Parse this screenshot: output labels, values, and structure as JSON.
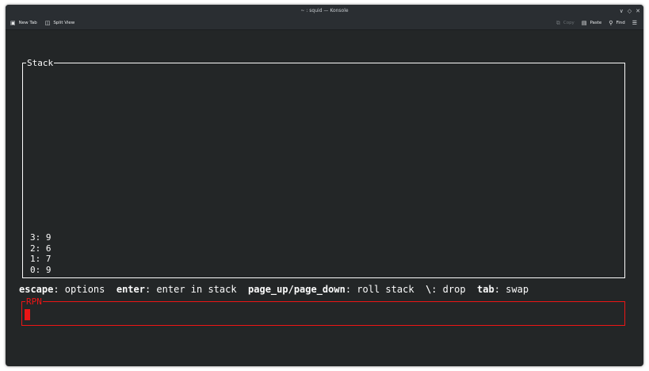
{
  "window": {
    "title": "~ : squid — Konsole",
    "controls": [
      "∨",
      "◇",
      "✕"
    ]
  },
  "toolbar": {
    "new_tab": "New Tab",
    "split_view": "Split View",
    "copy": "Copy",
    "paste": "Paste",
    "find": "Find"
  },
  "stack": {
    "title": "Stack",
    "items": [
      "3: 9",
      "2: 6",
      "1: 7",
      "0: 9"
    ]
  },
  "help": {
    "escape_key": "escape",
    "escape_desc": ": options  ",
    "enter_key": "enter",
    "enter_desc": ": enter in stack  ",
    "page_key": "page_up/page_down",
    "page_desc": ": roll stack  ",
    "drop_key": "\\",
    "drop_desc": ": drop  ",
    "tab_key": "tab",
    "tab_desc": ": swap"
  },
  "rpn": {
    "title": "RPN",
    "value": ""
  },
  "colors": {
    "background": "#232627",
    "foreground": "#fcfcfc",
    "accent_red": "#ed1515"
  }
}
